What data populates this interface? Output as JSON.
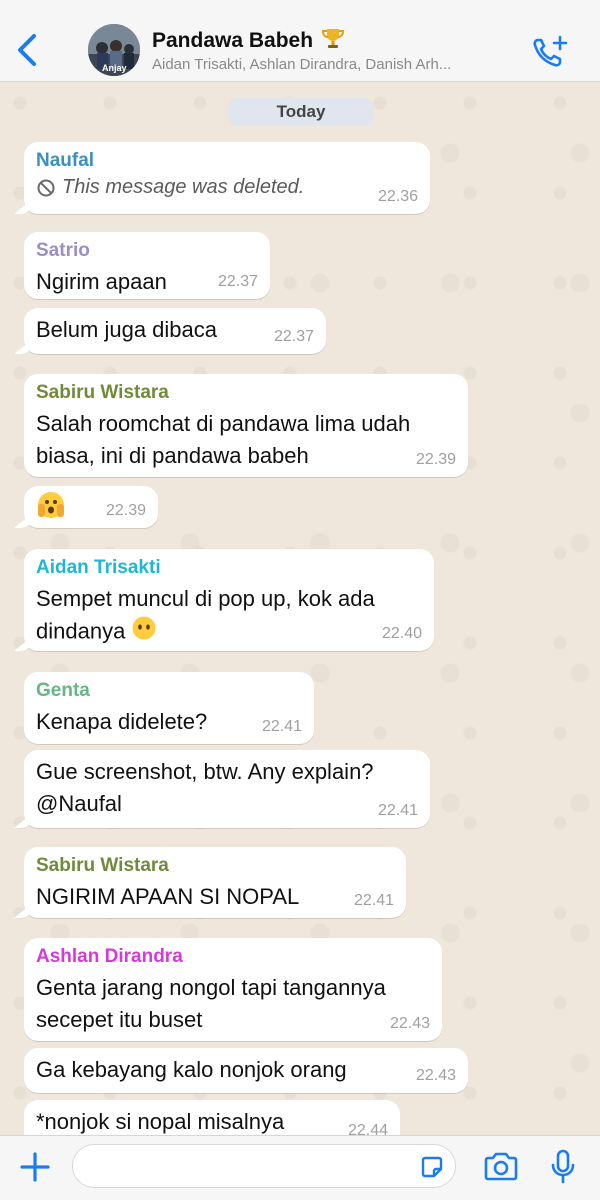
{
  "header": {
    "title": "Pandawa Babeh",
    "subtitle": "Aidan Trisakti, Ashlan Dirandra, Danish Arh...",
    "avatar_text": "Anjay"
  },
  "chat": {
    "date_label": "Today",
    "messages": [
      {
        "sender": "Naufal",
        "sender_color": "#3b8fc1",
        "deleted_text": "This message was deleted.",
        "time": "22.36"
      },
      {
        "sender": "Satrio",
        "sender_color": "#9b8ec7",
        "text": "Ngirim apaan",
        "time": "22.37"
      },
      {
        "text": "Belum juga dibaca",
        "time": "22.37"
      },
      {
        "sender": "Sabiru Wistara",
        "sender_color": "#6f8b3a",
        "text": "Salah roomchat di pandawa lima udah\nbiasa, ini di pandawa babeh",
        "time": "22.39"
      },
      {
        "emoji": "face-peeking-icon",
        "time": "22.39"
      },
      {
        "sender": "Aidan Trisakti",
        "sender_color": "#1fb7d4",
        "text": "Sempet muncul di pop up, kok ada\ndindanya",
        "emoji": "face-no-mouth-icon",
        "time": "22.40"
      },
      {
        "sender": "Genta",
        "sender_color": "#63b883",
        "text": "Kenapa didelete?",
        "time": "22.41"
      },
      {
        "text": "Gue screenshot, btw. Any explain?\n@Naufal",
        "time": "22.41"
      },
      {
        "sender": "Sabiru Wistara",
        "sender_color": "#6f8b3a",
        "text": "NGIRIM APAAN SI NOPAL",
        "time": "22.41"
      },
      {
        "sender": "Ashlan Dirandra",
        "sender_color": "#d63ad6",
        "text": "Genta jarang nongol tapi tangannya\nsecepet itu buset",
        "time": "22.43"
      },
      {
        "text": "Ga kebayang kalo nonjok orang",
        "time": "22.43"
      },
      {
        "text": "*nonjok si nopal misalnya",
        "time": "22.44"
      }
    ]
  },
  "colors": {
    "accent": "#1a7cf5",
    "chat_bg": "#efe7dc",
    "bubble": "#ffffff"
  },
  "icons": {
    "back": "chevron-left-icon",
    "call": "phone-add-icon",
    "trophy": "trophy-icon",
    "plus": "plus-icon",
    "sticker": "sticker-icon",
    "camera": "camera-icon",
    "mic": "microphone-icon",
    "deleted": "no-entry-icon"
  }
}
